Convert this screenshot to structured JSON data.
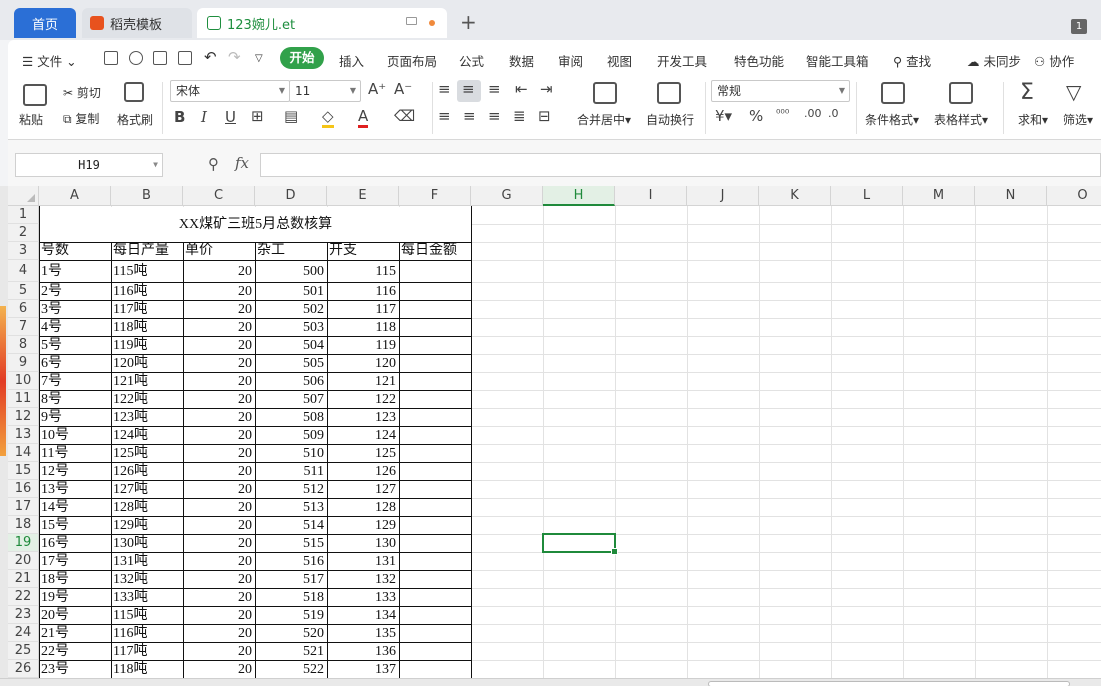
{
  "tabs": {
    "home": "首页",
    "template": "稻壳模板",
    "file": "123婉儿.et",
    "window_count": "1"
  },
  "menu": {
    "file": "文件",
    "items": [
      "开始",
      "插入",
      "页面布局",
      "公式",
      "数据",
      "审阅",
      "视图",
      "开发工具",
      "特色功能",
      "智能工具箱"
    ],
    "search": "查找",
    "unsynced": "未同步",
    "collab": "协作"
  },
  "ribbon": {
    "paste": "粘贴",
    "cut": "剪切",
    "copy": "复制",
    "format_painter": "格式刷",
    "font_name": "宋体",
    "font_size": "11",
    "merge_center": "合并居中",
    "wrap_text": "自动换行",
    "number_format": "常规",
    "conditional_format": "条件格式",
    "table_style": "表格样式",
    "sum": "求和",
    "filter": "筛选"
  },
  "formula_bar": {
    "name_box": "H19",
    "fx_label": "fx",
    "content": ""
  },
  "colors": {
    "accent_green": "#1f8a3b",
    "start_button": "#31a14a",
    "home_tab": "#2b6fd6"
  },
  "sheet": {
    "columns": [
      "A",
      "B",
      "C",
      "D",
      "E",
      "F",
      "G",
      "H",
      "I",
      "J",
      "K",
      "L",
      "M",
      "N",
      "O"
    ],
    "active_column": "H",
    "rows": [
      "1",
      "2",
      "3",
      "4",
      "5",
      "6",
      "7",
      "8",
      "9",
      "10",
      "11",
      "12",
      "13",
      "14",
      "15",
      "16",
      "17",
      "18",
      "19",
      "20",
      "21",
      "22",
      "23",
      "24",
      "25",
      "26"
    ],
    "active_row": "19",
    "title": "XX煤矿三班5月总数核算",
    "headers": [
      "号数",
      "每日产量",
      "单价",
      "杂工",
      "开支",
      "每日金额"
    ],
    "data": [
      [
        "1号",
        "115吨",
        "20",
        "500",
        "115",
        ""
      ],
      [
        "2号",
        "116吨",
        "20",
        "501",
        "116",
        ""
      ],
      [
        "3号",
        "117吨",
        "20",
        "502",
        "117",
        ""
      ],
      [
        "4号",
        "118吨",
        "20",
        "503",
        "118",
        ""
      ],
      [
        "5号",
        "119吨",
        "20",
        "504",
        "119",
        ""
      ],
      [
        "6号",
        "120吨",
        "20",
        "505",
        "120",
        ""
      ],
      [
        "7号",
        "121吨",
        "20",
        "506",
        "121",
        ""
      ],
      [
        "8号",
        "122吨",
        "20",
        "507",
        "122",
        ""
      ],
      [
        "9号",
        "123吨",
        "20",
        "508",
        "123",
        ""
      ],
      [
        "10号",
        "124吨",
        "20",
        "509",
        "124",
        ""
      ],
      [
        "11号",
        "125吨",
        "20",
        "510",
        "125",
        ""
      ],
      [
        "12号",
        "126吨",
        "20",
        "511",
        "126",
        ""
      ],
      [
        "13号",
        "127吨",
        "20",
        "512",
        "127",
        ""
      ],
      [
        "14号",
        "128吨",
        "20",
        "513",
        "128",
        ""
      ],
      [
        "15号",
        "129吨",
        "20",
        "514",
        "129",
        ""
      ],
      [
        "16号",
        "130吨",
        "20",
        "515",
        "130",
        ""
      ],
      [
        "17号",
        "131吨",
        "20",
        "516",
        "131",
        ""
      ],
      [
        "18号",
        "132吨",
        "20",
        "517",
        "132",
        ""
      ],
      [
        "19号",
        "133吨",
        "20",
        "518",
        "133",
        ""
      ],
      [
        "20号",
        "115吨",
        "20",
        "519",
        "134",
        ""
      ],
      [
        "21号",
        "116吨",
        "20",
        "520",
        "135",
        ""
      ],
      [
        "22号",
        "117吨",
        "20",
        "521",
        "136",
        ""
      ],
      [
        "23号",
        "118吨",
        "20",
        "522",
        "137",
        ""
      ]
    ]
  }
}
